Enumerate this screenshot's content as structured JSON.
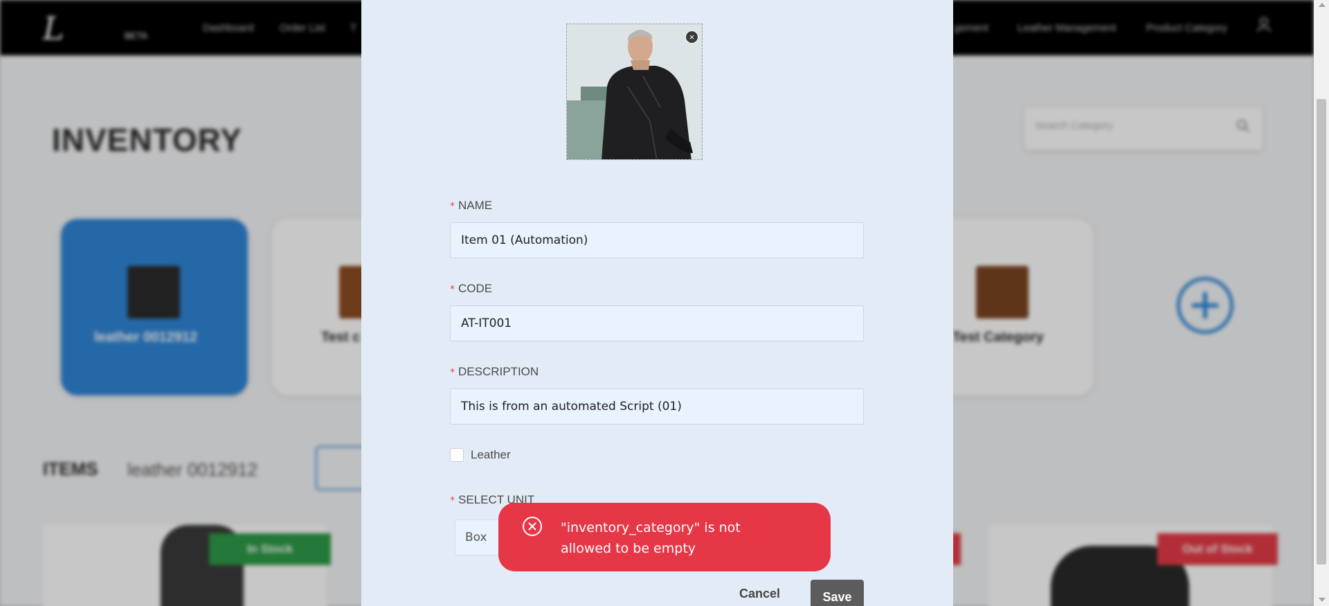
{
  "app": {
    "logo_text": "L",
    "logo_badge": "BETA",
    "nav": [
      "Dashboard",
      "Order List",
      "T",
      "gement",
      "Leather Management",
      "Product Category"
    ]
  },
  "page": {
    "title": "INVENTORY",
    "search_placeholder": "Search Category"
  },
  "categories": [
    {
      "label": "leather 0012912",
      "active": true
    },
    {
      "label": "Test c",
      "active": false
    },
    {
      "label": "Test Category",
      "active": false
    }
  ],
  "items": {
    "title": "ITEMS",
    "subtitle": "leather  0012912",
    "badges": [
      "In Stock",
      "Out of Stock"
    ]
  },
  "modal": {
    "name_label": "NAME",
    "name_value": "Item 01 (Automation)",
    "code_label": "CODE",
    "code_value": "AT-IT001",
    "description_label": "DESCRIPTION",
    "description_value": "This is from an automated Script (01)",
    "leather_label": "Leather",
    "leather_checked": false,
    "unit_label": "SELECT UNIT",
    "unit_value": "Box",
    "cancel_label": "Cancel",
    "save_label": "Save",
    "remove_image_glyph": "×"
  },
  "toast": {
    "message": "\"inventory_category\" is not allowed to be empty",
    "icon": "error-circle-x-icon",
    "color": "#e63747"
  },
  "colors": {
    "accent": "#2f86d6",
    "modal_bg": "#e3ecf6",
    "error": "#e63747",
    "in_stock": "#2e9b47",
    "out_of_stock": "#e53c47"
  }
}
